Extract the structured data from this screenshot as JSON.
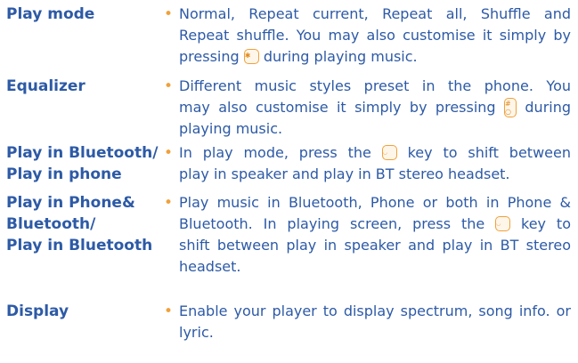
{
  "entries": [
    {
      "term_lines": [
        "Play mode"
      ],
      "desc": {
        "l1": "Normal, Repeat current, Repeat all, Shuffle and",
        "l2": "Repeat shuffle. You may also customise it simply by",
        "l3_before": "pressing",
        "l3_after": "during playing music.",
        "icon": "star-key-icon"
      }
    },
    {
      "term_lines": [
        "Equalizer"
      ],
      "desc": {
        "l1": "Different music styles preset in the phone. You",
        "l2_before": "may also customise it simply by pressing",
        "l2_after": "during",
        "l3": "playing music.",
        "icon": "hash-key-icon"
      }
    },
    {
      "term_lines": [
        "Play in Bluetooth/",
        "Play in phone"
      ],
      "desc": {
        "l1_before": "In play mode, press the",
        "l1_after": "key to shift between",
        "l2": "play in speaker and play in BT stereo headset.",
        "icon": "call-key-icon"
      }
    },
    {
      "term_lines": [
        "Play in Phone&",
        "Bluetooth/",
        "Play in Bluetooth"
      ],
      "desc": {
        "l1": "Play music in Bluetooth, Phone or both in Phone &",
        "l2_before": "Bluetooth. In playing screen, press the",
        "l2_after": "key to",
        "l3": "shift between play in speaker and play in BT stereo",
        "l4": "headset.",
        "icon": "call-key-icon"
      }
    },
    {
      "term_lines": [
        "Display"
      ],
      "desc": {
        "l1": "Enable your player to display spectrum, song info. or",
        "l2": "lyric."
      }
    }
  ],
  "bullet": "•",
  "colors": {
    "text": "#2d5aa6",
    "bullet": "#f0a13a"
  }
}
